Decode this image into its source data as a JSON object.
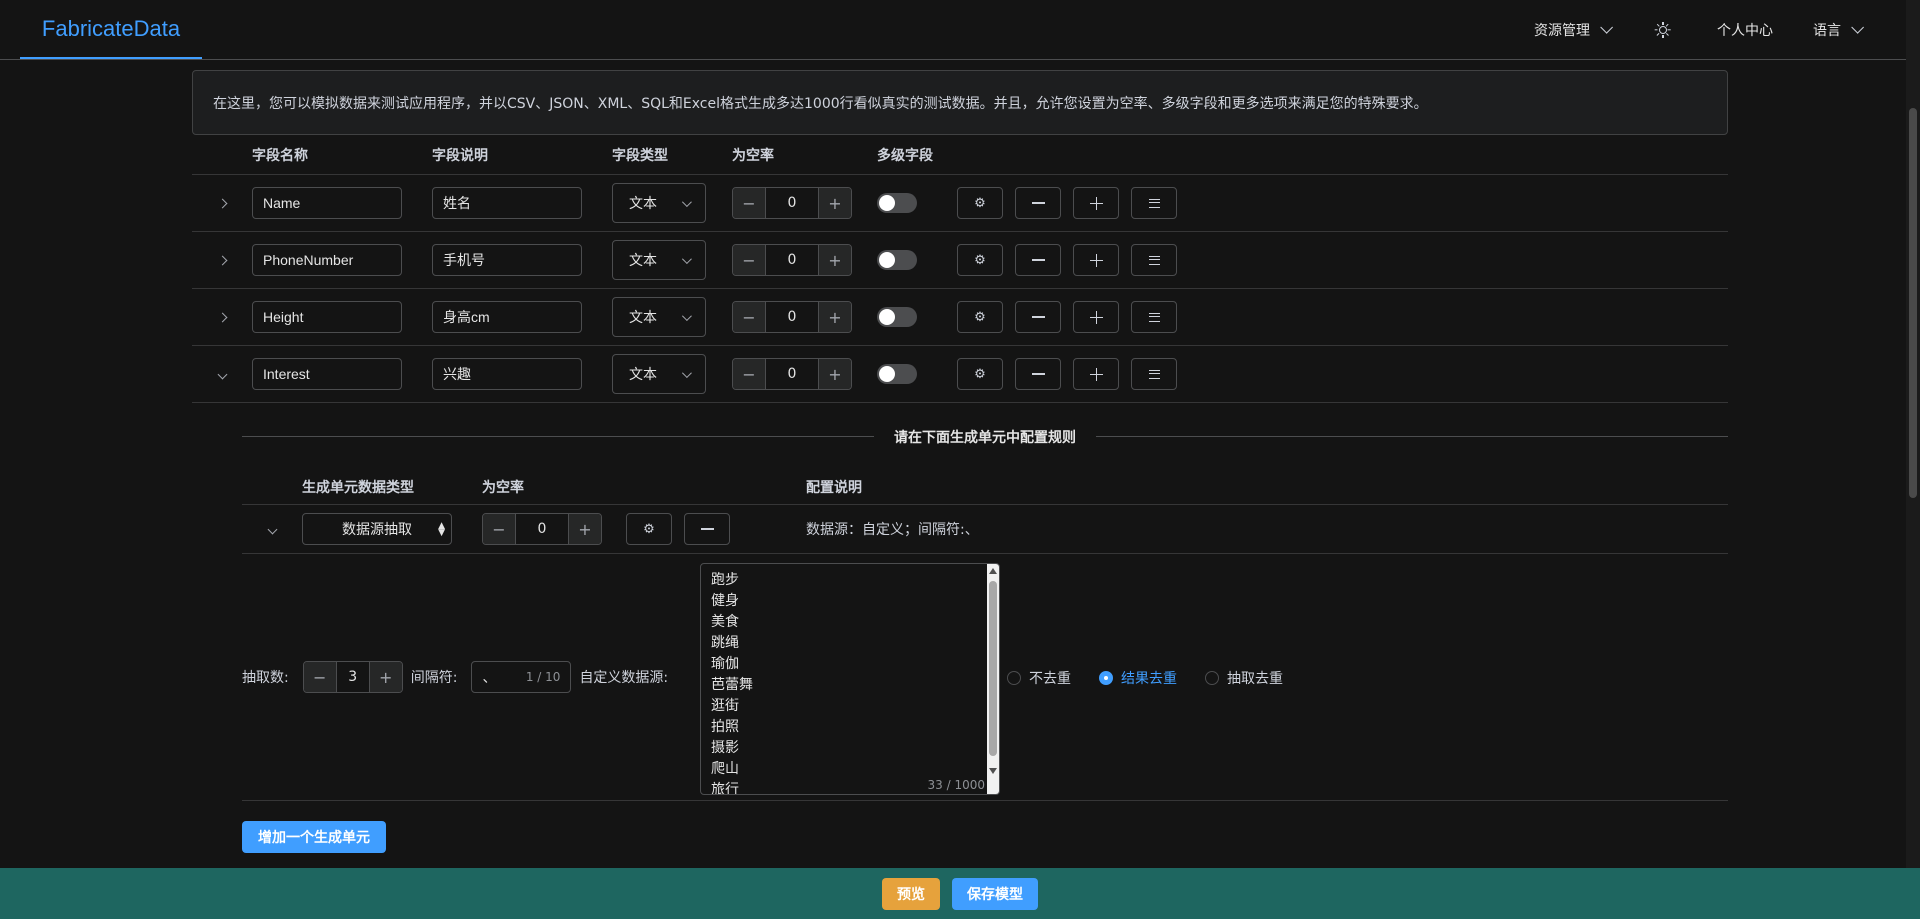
{
  "header": {
    "logo": "FabricateData",
    "resource_menu": "资源管理",
    "profile": "个人中心",
    "language": "语言"
  },
  "notice": "在这里，您可以模拟数据来测试应用程序，并以CSV、JSON、XML、SQL和Excel格式生成多达1000行看似真实的测试数据。并且，允许您设置为空率、多级字段和更多选项来满足您的特殊要求。",
  "table": {
    "headers": {
      "name": "字段名称",
      "desc": "字段说明",
      "type": "字段类型",
      "null_rate": "为空率",
      "multi": "多级字段"
    },
    "rows": [
      {
        "name": "Name",
        "desc": "姓名",
        "type": "文本",
        "null_rate": "0"
      },
      {
        "name": "PhoneNumber",
        "desc": "手机号",
        "type": "文本",
        "null_rate": "0"
      },
      {
        "name": "Height",
        "desc": "身高cm",
        "type": "文本",
        "null_rate": "0"
      },
      {
        "name": "Interest",
        "desc": "兴趣",
        "type": "文本",
        "null_rate": "0"
      }
    ]
  },
  "expanded": {
    "divider_text": "请在下面生成单元中配置规则",
    "headers": {
      "unit_type": "生成单元数据类型",
      "null_rate": "为空率",
      "config_desc": "配置说明"
    },
    "unit": {
      "type": "数据源抽取",
      "null_rate": "0",
      "config_desc": "数据源：自定义；间隔符:、"
    },
    "detail": {
      "extract_label": "抽取数:",
      "extract_value": "3",
      "separator_label": "间隔符:",
      "separator_value": "、",
      "separator_count": "1 / 10",
      "custom_source_label": "自定义数据源:",
      "source_items": [
        "跑步",
        "健身",
        "美食",
        "跳绳",
        "瑜伽",
        "芭蕾舞",
        "逛街",
        "拍照",
        "摄影",
        "爬山",
        "旅行"
      ],
      "source_count": "33 / 1000",
      "dedupe_options": [
        {
          "label": "不去重",
          "selected": false
        },
        {
          "label": "结果去重",
          "selected": true
        },
        {
          "label": "抽取去重",
          "selected": false
        }
      ]
    },
    "add_unit_button": "增加一个生成单元"
  },
  "footer": {
    "preview": "预览",
    "save": "保存模型"
  },
  "colors": {
    "accent": "#409eff",
    "warning": "#e6a23c",
    "footer_bg": "#1e6660"
  }
}
